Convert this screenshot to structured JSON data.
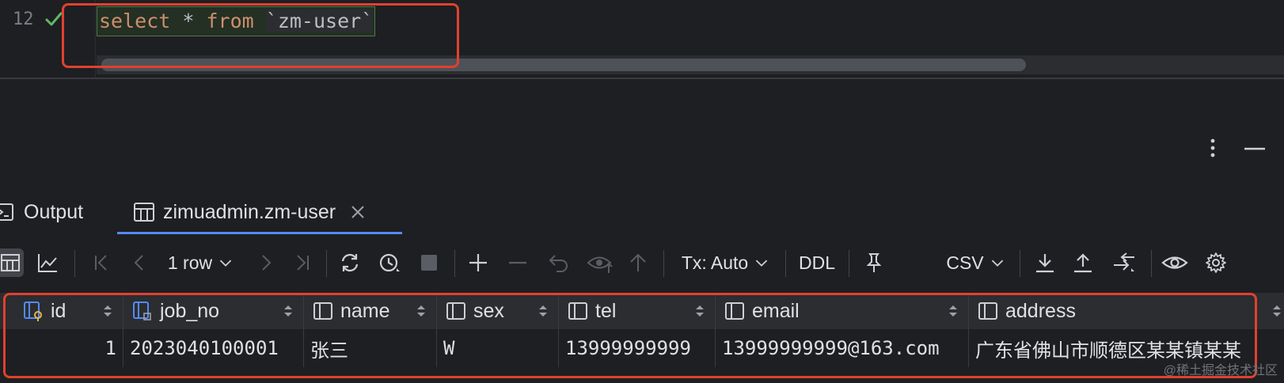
{
  "editor": {
    "line_number": "12",
    "query": {
      "kw_select": "select",
      "star": "*",
      "kw_from": "from",
      "table": "`zm-user`"
    }
  },
  "tool_window": {
    "tabs": [
      {
        "label": "Output",
        "icon": "console-icon"
      },
      {
        "label": "zimuadmin.zm-user",
        "icon": "table-icon",
        "active": true
      }
    ]
  },
  "toolbar": {
    "row_count": "1 row",
    "tx_mode": "Tx: Auto",
    "ddl_label": "DDL",
    "export_format": "CSV"
  },
  "grid": {
    "columns": [
      {
        "name": "id",
        "icon": "primary-key-column-icon"
      },
      {
        "name": "job_no",
        "icon": "index-column-icon"
      },
      {
        "name": "name",
        "icon": "column-icon"
      },
      {
        "name": "sex",
        "icon": "column-icon"
      },
      {
        "name": "tel",
        "icon": "column-icon"
      },
      {
        "name": "email",
        "icon": "column-icon"
      },
      {
        "name": "address",
        "icon": "column-icon"
      }
    ],
    "rows": [
      {
        "id": "1",
        "job_no": "2023040100001",
        "name": "张三",
        "sex": "W",
        "tel": "13999999999",
        "email": "13999999999@163.com",
        "address": "广东省佛山市顺德区某某镇某某"
      }
    ]
  },
  "watermark": "@稀土掘金技术社区",
  "colors": {
    "background": "#1e1f22",
    "keyword": "#cf8e6d",
    "highlight_annotation": "#e0412f",
    "active_tab_underline": "#548af7",
    "success_check": "#5fb865"
  }
}
